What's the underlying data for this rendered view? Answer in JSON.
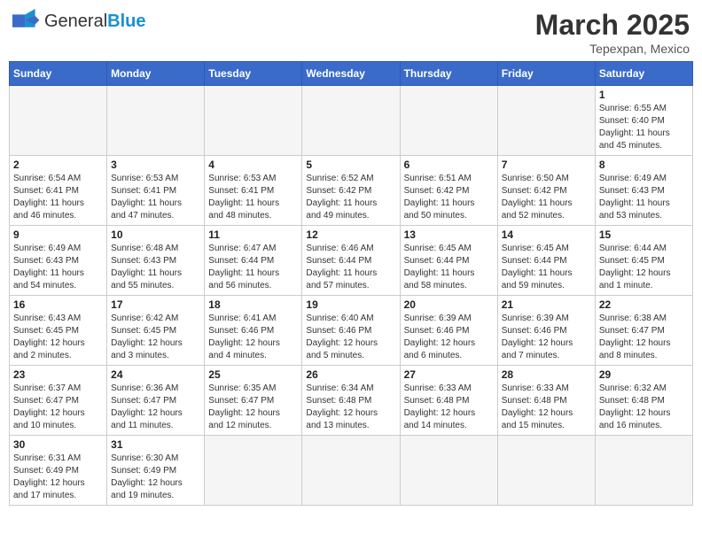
{
  "header": {
    "logo_text_general": "General",
    "logo_text_blue": "Blue",
    "month_title": "March 2025",
    "location": "Tepexpan, Mexico"
  },
  "weekdays": [
    "Sunday",
    "Monday",
    "Tuesday",
    "Wednesday",
    "Thursday",
    "Friday",
    "Saturday"
  ],
  "weeks": [
    [
      {
        "day": "",
        "info": ""
      },
      {
        "day": "",
        "info": ""
      },
      {
        "day": "",
        "info": ""
      },
      {
        "day": "",
        "info": ""
      },
      {
        "day": "",
        "info": ""
      },
      {
        "day": "",
        "info": ""
      },
      {
        "day": "1",
        "info": "Sunrise: 6:55 AM\nSunset: 6:40 PM\nDaylight: 11 hours\nand 45 minutes."
      }
    ],
    [
      {
        "day": "2",
        "info": "Sunrise: 6:54 AM\nSunset: 6:41 PM\nDaylight: 11 hours\nand 46 minutes."
      },
      {
        "day": "3",
        "info": "Sunrise: 6:53 AM\nSunset: 6:41 PM\nDaylight: 11 hours\nand 47 minutes."
      },
      {
        "day": "4",
        "info": "Sunrise: 6:53 AM\nSunset: 6:41 PM\nDaylight: 11 hours\nand 48 minutes."
      },
      {
        "day": "5",
        "info": "Sunrise: 6:52 AM\nSunset: 6:42 PM\nDaylight: 11 hours\nand 49 minutes."
      },
      {
        "day": "6",
        "info": "Sunrise: 6:51 AM\nSunset: 6:42 PM\nDaylight: 11 hours\nand 50 minutes."
      },
      {
        "day": "7",
        "info": "Sunrise: 6:50 AM\nSunset: 6:42 PM\nDaylight: 11 hours\nand 52 minutes."
      },
      {
        "day": "8",
        "info": "Sunrise: 6:49 AM\nSunset: 6:43 PM\nDaylight: 11 hours\nand 53 minutes."
      }
    ],
    [
      {
        "day": "9",
        "info": "Sunrise: 6:49 AM\nSunset: 6:43 PM\nDaylight: 11 hours\nand 54 minutes."
      },
      {
        "day": "10",
        "info": "Sunrise: 6:48 AM\nSunset: 6:43 PM\nDaylight: 11 hours\nand 55 minutes."
      },
      {
        "day": "11",
        "info": "Sunrise: 6:47 AM\nSunset: 6:44 PM\nDaylight: 11 hours\nand 56 minutes."
      },
      {
        "day": "12",
        "info": "Sunrise: 6:46 AM\nSunset: 6:44 PM\nDaylight: 11 hours\nand 57 minutes."
      },
      {
        "day": "13",
        "info": "Sunrise: 6:45 AM\nSunset: 6:44 PM\nDaylight: 11 hours\nand 58 minutes."
      },
      {
        "day": "14",
        "info": "Sunrise: 6:45 AM\nSunset: 6:44 PM\nDaylight: 11 hours\nand 59 minutes."
      },
      {
        "day": "15",
        "info": "Sunrise: 6:44 AM\nSunset: 6:45 PM\nDaylight: 12 hours\nand 1 minute."
      }
    ],
    [
      {
        "day": "16",
        "info": "Sunrise: 6:43 AM\nSunset: 6:45 PM\nDaylight: 12 hours\nand 2 minutes."
      },
      {
        "day": "17",
        "info": "Sunrise: 6:42 AM\nSunset: 6:45 PM\nDaylight: 12 hours\nand 3 minutes."
      },
      {
        "day": "18",
        "info": "Sunrise: 6:41 AM\nSunset: 6:46 PM\nDaylight: 12 hours\nand 4 minutes."
      },
      {
        "day": "19",
        "info": "Sunrise: 6:40 AM\nSunset: 6:46 PM\nDaylight: 12 hours\nand 5 minutes."
      },
      {
        "day": "20",
        "info": "Sunrise: 6:39 AM\nSunset: 6:46 PM\nDaylight: 12 hours\nand 6 minutes."
      },
      {
        "day": "21",
        "info": "Sunrise: 6:39 AM\nSunset: 6:46 PM\nDaylight: 12 hours\nand 7 minutes."
      },
      {
        "day": "22",
        "info": "Sunrise: 6:38 AM\nSunset: 6:47 PM\nDaylight: 12 hours\nand 8 minutes."
      }
    ],
    [
      {
        "day": "23",
        "info": "Sunrise: 6:37 AM\nSunset: 6:47 PM\nDaylight: 12 hours\nand 10 minutes."
      },
      {
        "day": "24",
        "info": "Sunrise: 6:36 AM\nSunset: 6:47 PM\nDaylight: 12 hours\nand 11 minutes."
      },
      {
        "day": "25",
        "info": "Sunrise: 6:35 AM\nSunset: 6:47 PM\nDaylight: 12 hours\nand 12 minutes."
      },
      {
        "day": "26",
        "info": "Sunrise: 6:34 AM\nSunset: 6:48 PM\nDaylight: 12 hours\nand 13 minutes."
      },
      {
        "day": "27",
        "info": "Sunrise: 6:33 AM\nSunset: 6:48 PM\nDaylight: 12 hours\nand 14 minutes."
      },
      {
        "day": "28",
        "info": "Sunrise: 6:33 AM\nSunset: 6:48 PM\nDaylight: 12 hours\nand 15 minutes."
      },
      {
        "day": "29",
        "info": "Sunrise: 6:32 AM\nSunset: 6:48 PM\nDaylight: 12 hours\nand 16 minutes."
      }
    ],
    [
      {
        "day": "30",
        "info": "Sunrise: 6:31 AM\nSunset: 6:49 PM\nDaylight: 12 hours\nand 17 minutes."
      },
      {
        "day": "31",
        "info": "Sunrise: 6:30 AM\nSunset: 6:49 PM\nDaylight: 12 hours\nand 19 minutes."
      },
      {
        "day": "",
        "info": ""
      },
      {
        "day": "",
        "info": ""
      },
      {
        "day": "",
        "info": ""
      },
      {
        "day": "",
        "info": ""
      },
      {
        "day": "",
        "info": ""
      }
    ]
  ]
}
